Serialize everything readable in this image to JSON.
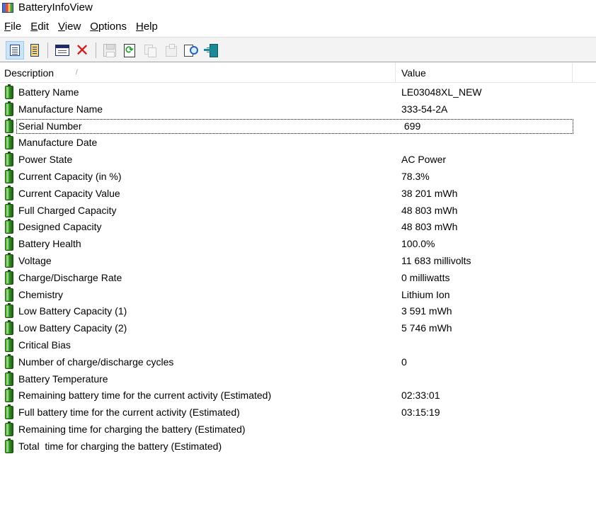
{
  "window": {
    "title": "BatteryInfoView"
  },
  "menu": [
    {
      "label": "File",
      "accel": "F",
      "rest": "ile"
    },
    {
      "label": "Edit",
      "accel": "E",
      "rest": "dit"
    },
    {
      "label": "View",
      "accel": "V",
      "rest": "iew"
    },
    {
      "label": "Options",
      "accel": "O",
      "rest": "ptions"
    },
    {
      "label": "Help",
      "accel": "H",
      "rest": "elp"
    }
  ],
  "toolbar": {
    "buttons": [
      {
        "name": "battery-info-mode",
        "icon": "properties-icon",
        "active": true,
        "enabled": true
      },
      {
        "name": "battery-log-mode",
        "icon": "list-icon",
        "active": false,
        "enabled": true
      },
      {
        "name": "html-report",
        "icon": "window-icon",
        "active": false,
        "enabled": true
      },
      {
        "name": "delete",
        "icon": "delete-icon",
        "active": false,
        "enabled": true
      },
      {
        "name": "save",
        "icon": "save-icon",
        "active": false,
        "enabled": false
      },
      {
        "name": "refresh",
        "icon": "refresh-icon",
        "active": false,
        "enabled": true
      },
      {
        "name": "copy",
        "icon": "copy-icon",
        "active": false,
        "enabled": false
      },
      {
        "name": "properties",
        "icon": "report-icon",
        "active": false,
        "enabled": false
      },
      {
        "name": "find",
        "icon": "find-icon",
        "active": false,
        "enabled": true
      },
      {
        "name": "exit",
        "icon": "exit-icon",
        "active": false,
        "enabled": true
      }
    ]
  },
  "columns": {
    "description": "Description",
    "sort_indicator": "/",
    "value": "Value"
  },
  "rows": [
    {
      "description": "Battery Name",
      "value": "LE03048XL_NEW"
    },
    {
      "description": "Manufacture Name",
      "value": "333-54-2A"
    },
    {
      "description": "Serial Number",
      "value": " 699",
      "focused": true
    },
    {
      "description": "Manufacture Date",
      "value": ""
    },
    {
      "description": "Power State",
      "value": "AC Power"
    },
    {
      "description": "Current Capacity (in %)",
      "value": "78.3%"
    },
    {
      "description": "Current Capacity Value",
      "value": "38 201 mWh"
    },
    {
      "description": "Full Charged Capacity",
      "value": "48 803 mWh"
    },
    {
      "description": "Designed Capacity",
      "value": "48 803 mWh"
    },
    {
      "description": "Battery Health",
      "value": "100.0%"
    },
    {
      "description": "Voltage",
      "value": "11 683 millivolts"
    },
    {
      "description": "Charge/Discharge Rate",
      "value": "0 milliwatts"
    },
    {
      "description": "Chemistry",
      "value": "Lithium Ion"
    },
    {
      "description": "Low Battery Capacity (1)",
      "value": "3 591 mWh"
    },
    {
      "description": "Low Battery Capacity (2)",
      "value": "5 746 mWh"
    },
    {
      "description": "Critical Bias",
      "value": ""
    },
    {
      "description": "Number of charge/discharge cycles",
      "value": "0"
    },
    {
      "description": "Battery Temperature",
      "value": ""
    },
    {
      "description": "Remaining battery time for the current activity (Estimated)",
      "value": "02:33:01"
    },
    {
      "description": "Full battery time for the current activity (Estimated)",
      "value": "03:15:19"
    },
    {
      "description": "Remaining time for charging the battery (Estimated)",
      "value": ""
    },
    {
      "description": "Total  time for charging the battery (Estimated)",
      "value": ""
    }
  ],
  "colors": {
    "battery_icon": "#2f8f1f",
    "delete_icon": "#d91a1a",
    "active_button": "#cce4f7"
  }
}
